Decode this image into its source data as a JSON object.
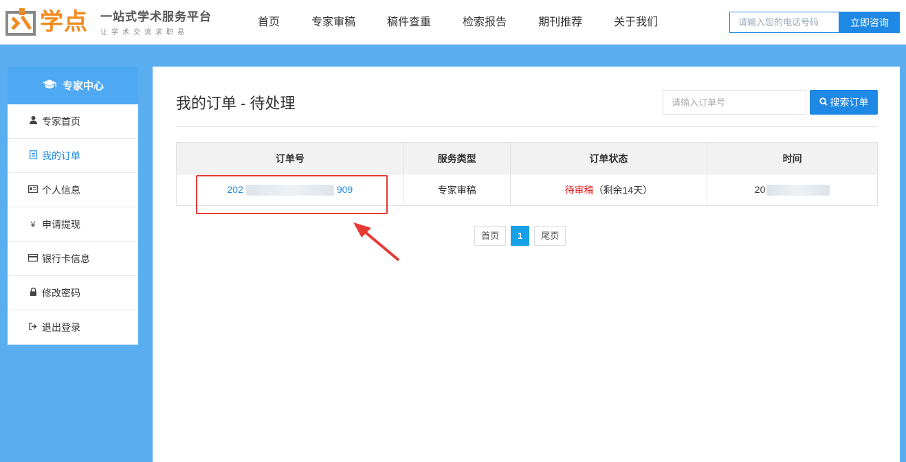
{
  "brand": {
    "name": "学点",
    "tagline": "一站式学术服务平台",
    "slogan": "让学术交流求职易"
  },
  "nav": {
    "items": [
      {
        "label": "首页"
      },
      {
        "label": "专家审稿"
      },
      {
        "label": "稿件查重"
      },
      {
        "label": "检索报告"
      },
      {
        "label": "期刊推荐"
      },
      {
        "label": "关于我们"
      }
    ]
  },
  "consult": {
    "placeholder": "请输入您的电话号码",
    "button_label": "立即咨询"
  },
  "sidebar": {
    "title": "专家中心",
    "items": [
      {
        "label": "专家首页",
        "icon": "user-icon"
      },
      {
        "label": "我的订单",
        "icon": "document-icon"
      },
      {
        "label": "个人信息",
        "icon": "id-card-icon"
      },
      {
        "label": "申请提现",
        "icon": "yen-icon"
      },
      {
        "label": "银行卡信息",
        "icon": "credit-card-icon"
      },
      {
        "label": "修改密码",
        "icon": "lock-icon"
      },
      {
        "label": "退出登录",
        "icon": "logout-icon"
      }
    ]
  },
  "main": {
    "title": "我的订单 - 待处理",
    "search_placeholder": "请输入订单号",
    "search_button": "搜索订单",
    "table": {
      "headers": [
        "订单号",
        "服务类型",
        "订单状态",
        "时间"
      ],
      "rows": [
        {
          "order_prefix": "202",
          "order_suffix": "909",
          "service": "专家审稿",
          "status": "待审稿",
          "status_note": "（剩余14天）",
          "time_prefix": "20"
        }
      ]
    },
    "pager": {
      "first": "首页",
      "current": "1",
      "last": "尾页"
    }
  },
  "colors": {
    "accent": "#1e88e5",
    "background": "#5aaef0",
    "status": "#e02020",
    "highlight": "#e53935",
    "brand": "#f28b1f"
  }
}
